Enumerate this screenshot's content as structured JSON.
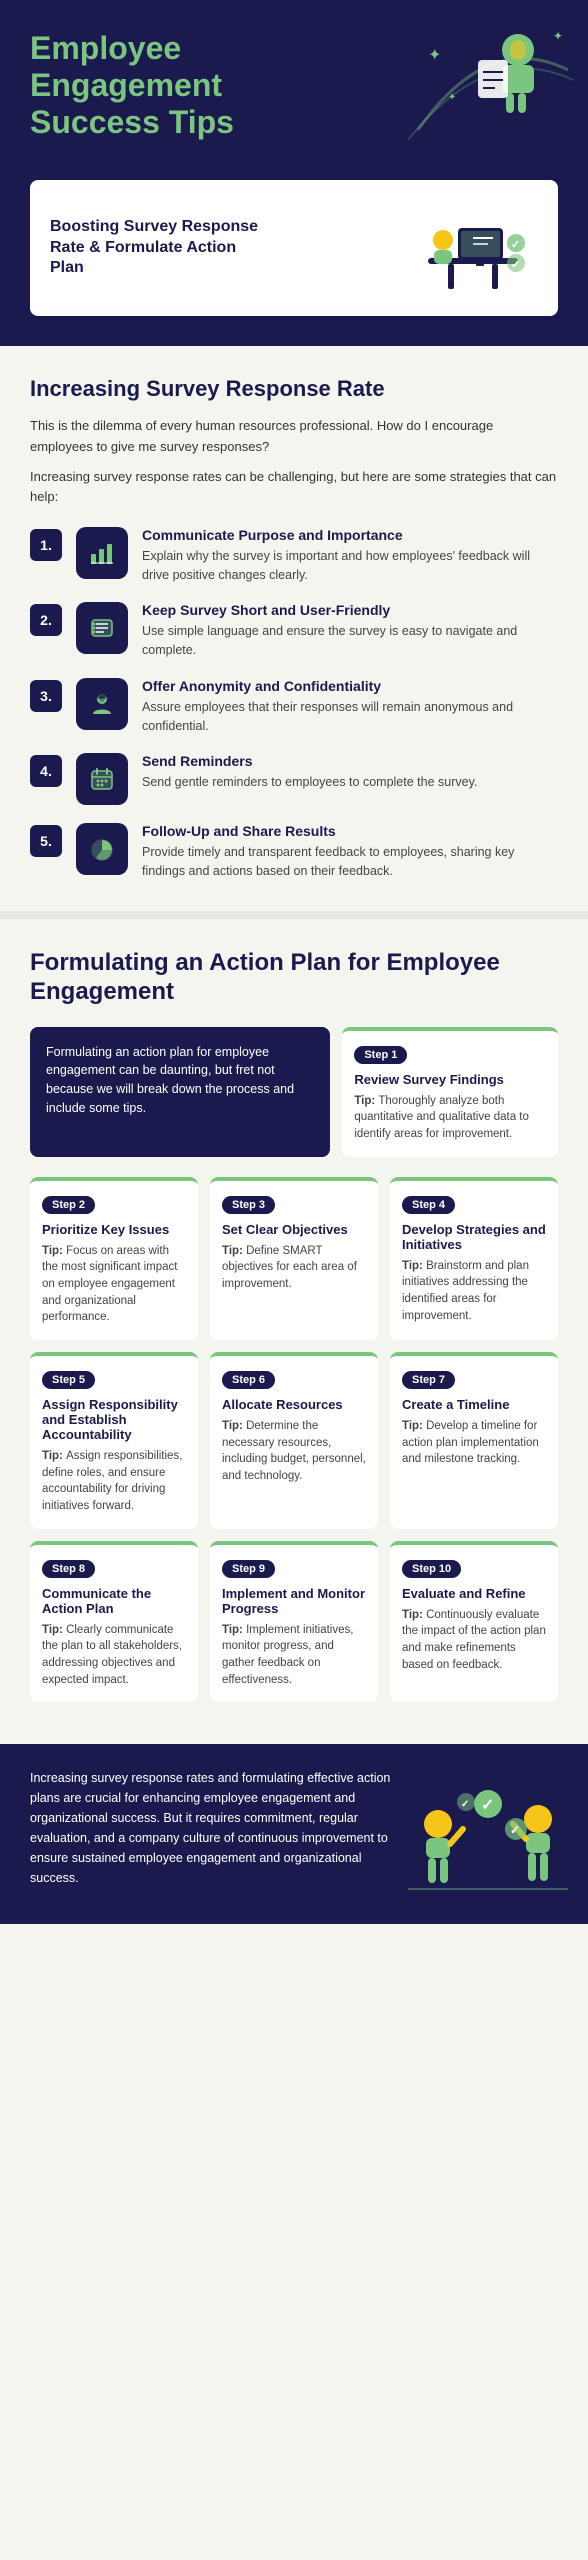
{
  "header": {
    "title": "Employee Engagement Success Tips"
  },
  "subtitle": {
    "text": "Boosting Survey Response Rate & Formulate Action Plan"
  },
  "survey_section": {
    "title": "Increasing Survey Response Rate",
    "intro1": "This is the dilemma of every human resources professional. How do I encourage employees to give me survey responses?",
    "intro2": "Increasing survey response rates can be challenging, but here are some strategies that can help:",
    "tips": [
      {
        "number": "1.",
        "title": "Communicate Purpose and Importance",
        "desc": "Explain why the survey is important and how employees' feedback will drive positive changes clearly.",
        "icon": "chart-icon"
      },
      {
        "number": "2.",
        "title": "Keep Survey Short and User-Friendly",
        "desc": "Use simple language and ensure the survey is easy to navigate and complete.",
        "icon": "list-icon"
      },
      {
        "number": "3.",
        "title": "Offer Anonymity and Confidentiality",
        "desc": "Assure employees that their responses will remain anonymous and confidential.",
        "icon": "person-icon"
      },
      {
        "number": "4.",
        "title": "Send Reminders",
        "desc": "Send gentle reminders to employees to complete the survey.",
        "icon": "calendar-icon"
      },
      {
        "number": "5.",
        "title": "Follow-Up and Share Results",
        "desc": "Provide timely and transparent feedback to employees, sharing key findings and actions based on their feedback.",
        "icon": "pie-icon"
      }
    ]
  },
  "action_section": {
    "title": "Formulating an Action Plan for Employee Engagement",
    "intro": "Formulating an action plan for employee engagement can be daunting, but fret not because we will break down the process and include some tips.",
    "steps": [
      {
        "step": "Step 1",
        "title": "Review Survey Findings",
        "tip": "Thoroughly analyze both quantitative and qualitative data to identify areas for improvement."
      },
      {
        "step": "Step 2",
        "title": "Prioritize Key Issues",
        "tip": "Focus on areas with the most significant impact on employee engagement and organizational performance."
      },
      {
        "step": "Step 3",
        "title": "Set Clear Objectives",
        "tip": "Define SMART objectives for each area of improvement."
      },
      {
        "step": "Step 4",
        "title": "Develop Strategies and Initiatives",
        "tip": "Brainstorm and plan initiatives addressing the identified areas for improvement."
      },
      {
        "step": "Step 5",
        "title": "Assign Responsibility and Establish Accountability",
        "tip": "Assign responsibilities, define roles, and ensure accountability for driving initiatives forward."
      },
      {
        "step": "Step 6",
        "title": "Allocate Resources",
        "tip": "Determine the necessary resources, including budget, personnel, and technology."
      },
      {
        "step": "Step 7",
        "title": "Create a Timeline",
        "tip": "Develop a timeline for action plan implementation and milestone tracking."
      },
      {
        "step": "Step 8",
        "title": "Communicate the Action Plan",
        "tip": "Clearly communicate the plan to all stakeholders, addressing objectives and expected impact."
      },
      {
        "step": "Step 9",
        "title": "Implement and Monitor Progress",
        "tip": "Implement initiatives, monitor progress, and gather feedback on effectiveness."
      },
      {
        "step": "Step 10",
        "title": "Evaluate and Refine",
        "tip": "Continuously evaluate the impact of the action plan and make refinements based on feedback."
      }
    ]
  },
  "footer": {
    "text": "Increasing survey response rates and formulating effective action plans are crucial for enhancing employee engagement and organizational success. But it requires commitment, regular evaluation, and a company culture of continuous improvement to ensure sustained employee engagement and organizational success."
  },
  "colors": {
    "dark_navy": "#1a1a4e",
    "green": "#7bc67e",
    "bg": "#f5f5f0",
    "white": "#ffffff"
  }
}
